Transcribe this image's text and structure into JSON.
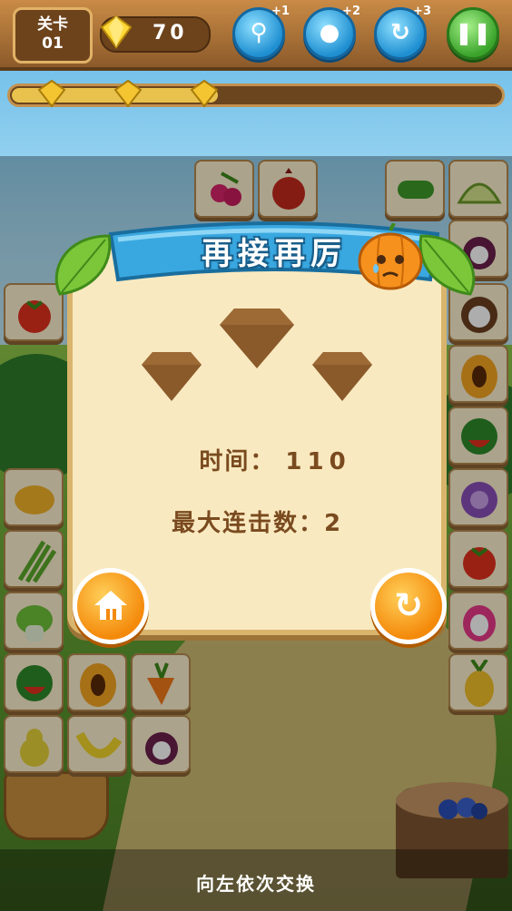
{
  "hud": {
    "level_label": "关卡",
    "level_number": "01",
    "gem_count": "70",
    "tools": [
      {
        "name": "magnifier",
        "badge": "+1"
      },
      {
        "name": "bomb",
        "badge": "+2"
      },
      {
        "name": "shuffle",
        "badge": "+3"
      }
    ],
    "pause_icon": "pause-icon"
  },
  "progress": {
    "fraction": 0.42,
    "star_gems": 3
  },
  "dialog": {
    "title": "再接再厉",
    "stars_earned": 0,
    "stars_total": 3,
    "time_label": "时间：",
    "time_value": "110",
    "combo_label": "最大连击数：",
    "combo_value": "2"
  },
  "hint": {
    "text": "向左依次交换"
  },
  "colors": {
    "wood": "#c98b46",
    "tool_blue": "#1f8fd1",
    "pause_green": "#3aa32a",
    "button_orange": "#f48a0b",
    "banner_blue": "#3aa8e0",
    "dialog_bg": "#f9e9c0"
  },
  "tiles": [
    {
      "fruit": "raspberry"
    },
    {
      "fruit": "pomegranate"
    },
    {
      "fruit": "cucumber"
    },
    {
      "fruit": "melon"
    },
    {
      "fruit": "mangosteen"
    },
    {
      "fruit": "tomato"
    },
    {
      "fruit": "coconut"
    },
    {
      "fruit": "papaya"
    },
    {
      "fruit": "watermelon"
    },
    {
      "fruit": "mango"
    },
    {
      "fruit": "cabbage"
    },
    {
      "fruit": "asparagus"
    },
    {
      "fruit": "tomato"
    },
    {
      "fruit": "bok-choy"
    },
    {
      "fruit": "dragon-fruit"
    },
    {
      "fruit": "watermelon"
    },
    {
      "fruit": "papaya"
    },
    {
      "fruit": "carrot"
    },
    {
      "fruit": "pineapple"
    },
    {
      "fruit": "pear"
    },
    {
      "fruit": "banana"
    },
    {
      "fruit": "mangosteen"
    }
  ]
}
